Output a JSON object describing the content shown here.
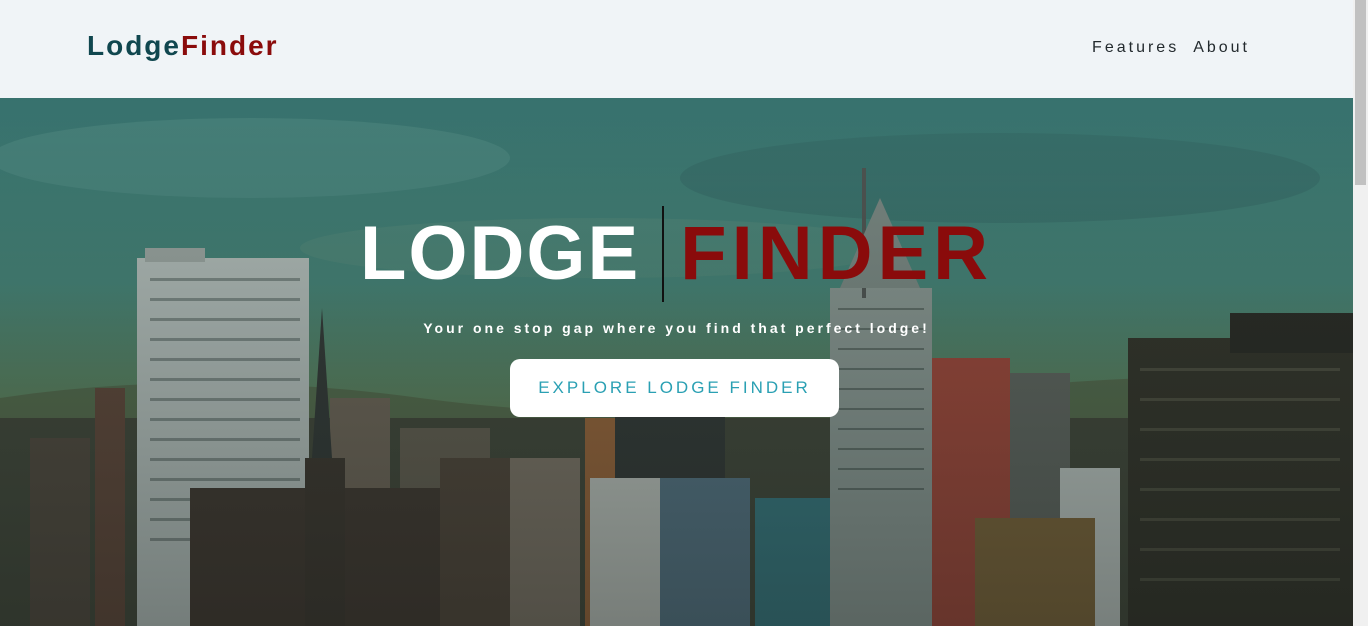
{
  "navbar": {
    "logo_part1": "Lodge",
    "logo_part2": "Finder",
    "links": [
      "Features",
      "About"
    ]
  },
  "hero": {
    "title_left": "LODGE",
    "title_right": "FINDER",
    "tagline": "Your one stop gap where you find that perfect lodge!",
    "cta_label": "EXPLORE LODGE FINDER"
  },
  "colors": {
    "brand_dark": "#10474f",
    "brand_red": "#8a0b0b",
    "cta_text": "#2aa0b3"
  }
}
